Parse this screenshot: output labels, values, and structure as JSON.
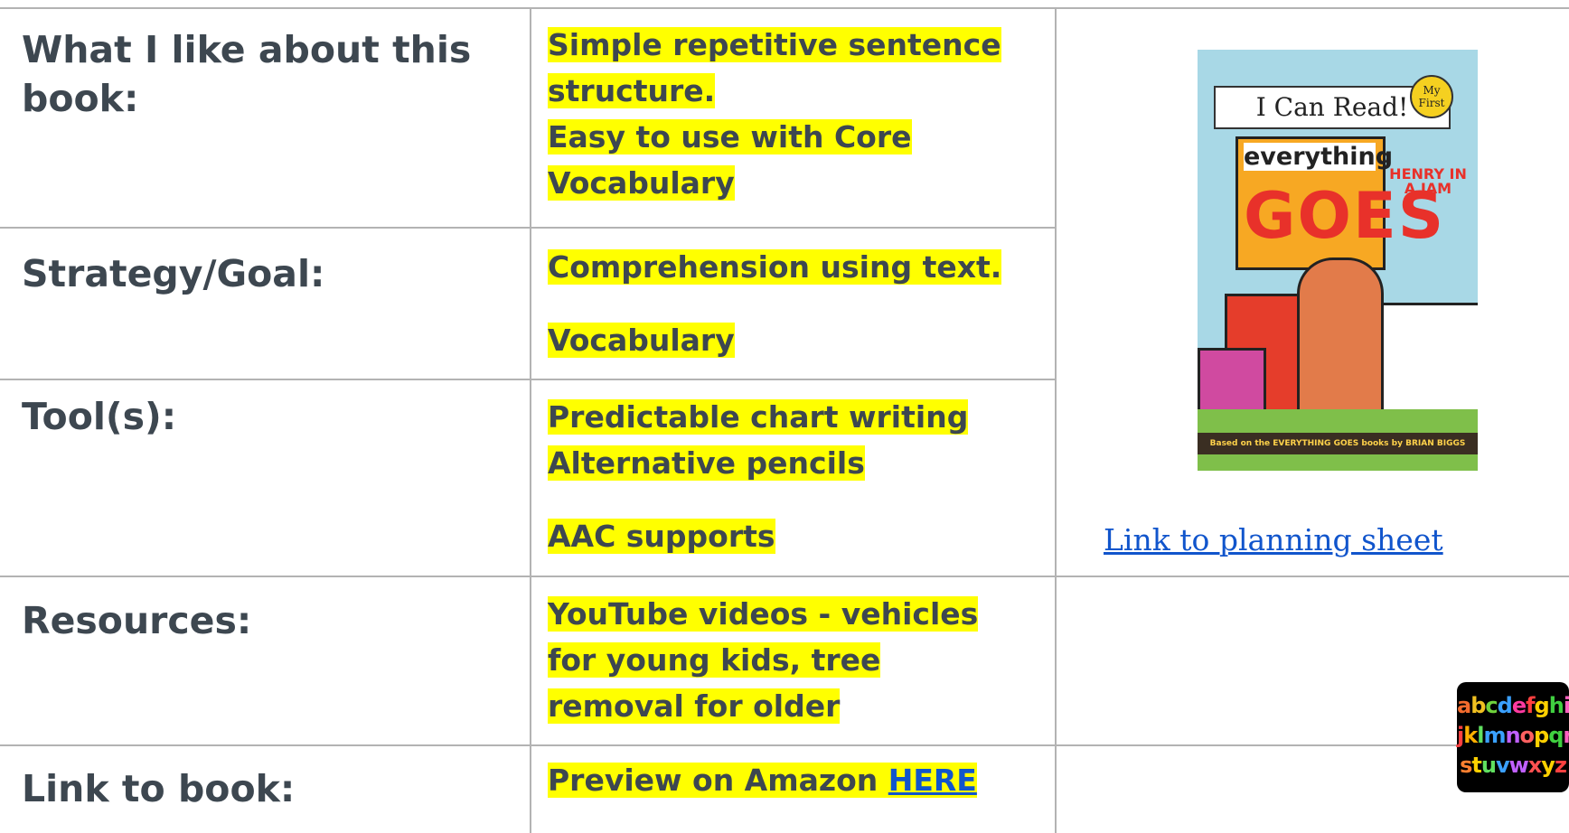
{
  "rows": [
    {
      "label": "What I like about this book:",
      "content": [
        "Simple repetitive sentence structure.",
        "Easy to use with Core Vocabulary"
      ]
    },
    {
      "label": "Strategy/Goal:",
      "content": [
        "Comprehension using text.",
        "Vocabulary"
      ]
    },
    {
      "label": "Tool(s):",
      "content": [
        "Predictable chart writing",
        "Alternative pencils",
        "AAC supports"
      ]
    },
    {
      "label": "Resources:",
      "content": [
        "YouTube videos - vehicles for young kids, tree removal for older"
      ]
    },
    {
      "label": "Link to book:",
      "content_prefix": "Preview on Amazon ",
      "content_link": "HERE"
    }
  ],
  "planning_link": "Link to planning sheet",
  "cover": {
    "banner": "I Can Read!",
    "badge": "My First",
    "word1": "everything",
    "word2": "GOES",
    "subtitle": "HENRY IN A JAM",
    "credit": "Based on the EVERYTHING GOES books by BRIAN BIGGS"
  },
  "alphabet": {
    "rows": [
      [
        [
          "a",
          "#f26b2d"
        ],
        [
          "b",
          "#f0c020"
        ],
        [
          "c",
          "#6fd23c"
        ],
        [
          "d",
          "#3aa0ff"
        ],
        [
          "e",
          "#ff3aa0"
        ],
        [
          "f",
          "#ff4040"
        ],
        [
          "g",
          "#ffd000"
        ],
        [
          "h",
          "#40d040"
        ],
        [
          "i",
          "#ff60c0"
        ]
      ],
      [
        [
          "j",
          "#ff4040"
        ],
        [
          "k",
          "#ffb000"
        ],
        [
          "l",
          "#60e060"
        ],
        [
          "m",
          "#3aa0ff"
        ],
        [
          "n",
          "#c060ff"
        ],
        [
          "o",
          "#ff6060"
        ],
        [
          "p",
          "#ffd000"
        ],
        [
          "q",
          "#40d040"
        ],
        [
          "r",
          "#ff60c0"
        ]
      ],
      [
        [
          "s",
          "#ff8030"
        ],
        [
          "t",
          "#ffd000"
        ],
        [
          "u",
          "#60e060"
        ],
        [
          "v",
          "#3aa0ff"
        ],
        [
          "w",
          "#c060ff"
        ],
        [
          "x",
          "#ff5050"
        ],
        [
          "y",
          "#ffd000"
        ],
        [
          "z",
          "#ff4040"
        ]
      ]
    ]
  },
  "colors": {
    "highlight": "#ffff00",
    "text": "#3d4750",
    "link": "#1155cc",
    "border": "#b3b3b3"
  }
}
